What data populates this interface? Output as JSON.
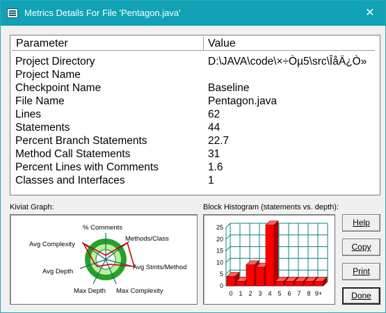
{
  "window": {
    "title": "Metrics Details For File 'Pentagon.java'",
    "close_glyph": "✕",
    "accent_color": "#11a3b5"
  },
  "table": {
    "headers": [
      "Parameter",
      "Value"
    ],
    "rows": [
      {
        "param": "Project Directory",
        "value": "D:\\JAVA\\code\\×÷Òµ5\\src\\ÎåÄ¿Ò»"
      },
      {
        "param": "Project Name",
        "value": ""
      },
      {
        "param": "Checkpoint Name",
        "value": "Baseline"
      },
      {
        "param": "File Name",
        "value": "Pentagon.java"
      },
      {
        "param": "Lines",
        "value": "62"
      },
      {
        "param": "Statements",
        "value": "44"
      },
      {
        "param": "Percent Branch Statements",
        "value": "22.7"
      },
      {
        "param": "Method Call Statements",
        "value": "31"
      },
      {
        "param": "Percent Lines with Comments",
        "value": "1.6"
      },
      {
        "param": "Classes and Interfaces",
        "value": "1"
      }
    ]
  },
  "kiviat": {
    "label": "Kiviat Graph:",
    "axes": [
      "% Comments",
      "Methods/Class",
      "Avg Stmts/Method",
      "Max Complexity",
      "Max Depth",
      "Avg Depth",
      "Avg Complexity"
    ]
  },
  "histogram": {
    "label": "Block Histogram (statements vs. depth):"
  },
  "chart_data": {
    "type": "bar",
    "title": "Block Histogram (statements vs. depth):",
    "categories": [
      "0",
      "1",
      "2",
      "3",
      "4",
      "5",
      "6",
      "7",
      "8",
      "9+"
    ],
    "values": [
      4,
      2,
      9,
      8,
      26,
      2,
      2,
      2,
      2,
      2
    ],
    "ylim": [
      0,
      25
    ],
    "yticks": [
      "0",
      "5",
      "10",
      "15",
      "20",
      "25"
    ],
    "bar_color": "#ff0000",
    "grid_color": "#0c8080",
    "grid": true
  },
  "buttons": {
    "help": "Help",
    "copy": "Copy",
    "print": "Print",
    "done": "Done"
  }
}
